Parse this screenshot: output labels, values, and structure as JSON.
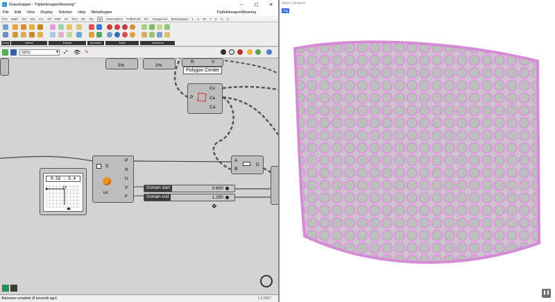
{
  "window": {
    "title": "Grasshopper - TripleHexagonWeaving*",
    "document": "TripleHexagonWeaving"
  },
  "menu": [
    "File",
    "Edit",
    "View",
    "Display",
    "Solution",
    "Help",
    "MetaHopper"
  ],
  "tabs": [
    "Prm",
    "Math",
    "Set",
    "Vec",
    "Crv",
    "Srf",
    "Msh",
    "Int",
    "Trns",
    "Dis",
    "Fly",
    "W",
    "Heteroptera",
    "PufferFish",
    "M+",
    "Kangaroo2",
    "MetaHopper",
    "L",
    "A",
    "W",
    "Y",
    "K",
    "C",
    "C"
  ],
  "active_tab_index": 11,
  "ribbon_groups": [
    "Creat.",
    "Define",
    "Extract",
    "Smoother",
    "SubD",
    "Transform"
  ],
  "zoom": "161%",
  "status": {
    "message": "Autosave complete (8 seconds ago)",
    "version": "1.0.0007"
  },
  "canvas": {
    "pct_left": "5%",
    "pct_right": "2%",
    "polygon_center": {
      "tooltip": "Polygon Center",
      "input": "P",
      "outputs": [
        "Cv",
        "Ce",
        "Ca"
      ],
      "top_inputs": [
        "R",
        "V"
      ]
    },
    "uv_node": {
      "inputs": [
        "S"
      ],
      "outputs": [
        "P",
        "N",
        "U",
        "V",
        "F"
      ],
      "name": "uv"
    },
    "merge_node": {
      "inputs": [
        "A",
        "B"
      ],
      "output": "D"
    },
    "graph_mapper_readout": "0.56 : 0.4",
    "sliders": [
      {
        "name": "Domain start",
        "value": "0.800"
      },
      {
        "name": "Domain end",
        "value": "1.250"
      }
    ]
  },
  "viewport": {
    "title": "Rhino Viewport",
    "view": "Top"
  }
}
